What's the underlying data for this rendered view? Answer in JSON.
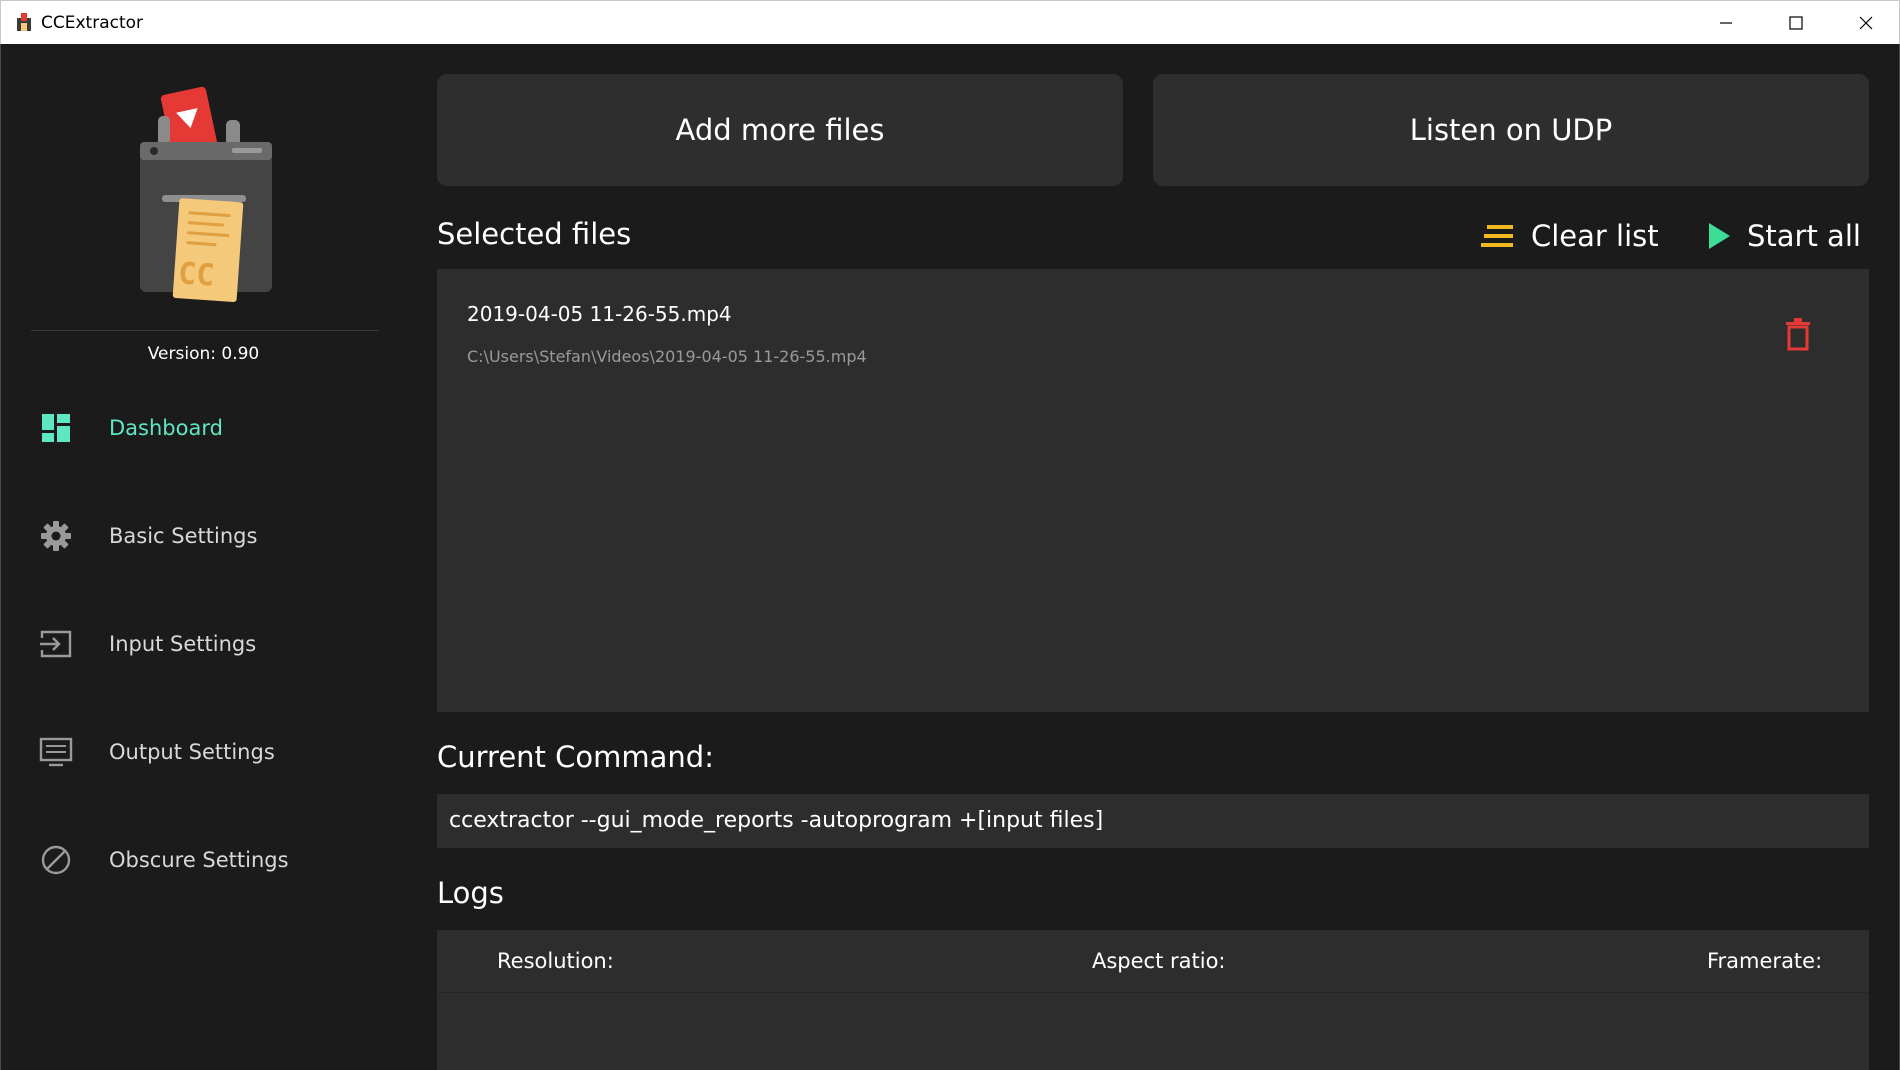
{
  "window": {
    "title": "CCExtractor"
  },
  "sidebar": {
    "version": "Version: 0.90",
    "items": [
      {
        "label": "Dashboard",
        "icon": "dashboard-icon",
        "active": true
      },
      {
        "label": "Basic Settings",
        "icon": "gear-icon",
        "active": false
      },
      {
        "label": "Input Settings",
        "icon": "input-icon",
        "active": false
      },
      {
        "label": "Output Settings",
        "icon": "monitor-icon",
        "active": false
      },
      {
        "label": "Obscure Settings",
        "icon": "block-icon",
        "active": false
      }
    ]
  },
  "main": {
    "add_files_label": "Add more files",
    "listen_udp_label": "Listen on UDP",
    "selected_files_title": "Selected files",
    "clear_list_label": "Clear list",
    "start_all_label": "Start all",
    "files": [
      {
        "name": "2019-04-05 11-26-55.mp4",
        "path": "C:\\Users\\Stefan\\Videos\\2019-04-05 11-26-55.mp4"
      }
    ],
    "command_title": "Current Command:",
    "command": "ccextractor --gui_mode_reports -autoprogram +[input files]",
    "logs_title": "Logs",
    "logs_columns": [
      "Resolution:",
      "Aspect ratio:",
      "Framerate:"
    ]
  },
  "colors": {
    "accent": "#5fe6c3",
    "clear_icon": "#f5b820",
    "start_icon": "#3ddc97",
    "delete_icon": "#e53935",
    "panel": "#2d2d2d",
    "background": "#1b1b1b"
  }
}
